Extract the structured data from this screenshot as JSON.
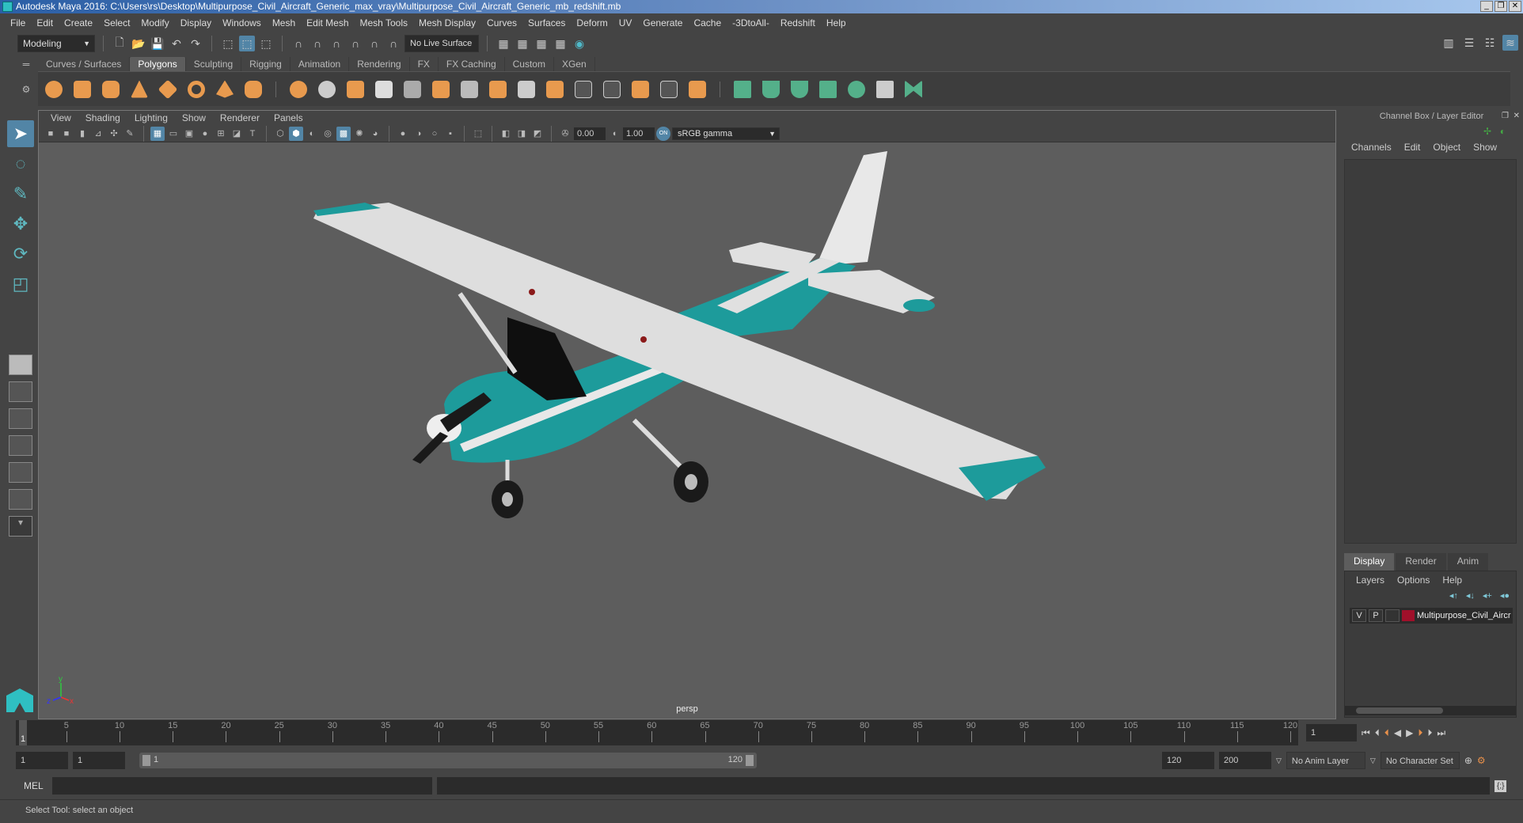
{
  "window": {
    "title": "Autodesk Maya 2016: C:\\Users\\rs\\Desktop\\Multipurpose_Civil_Aircraft_Generic_max_vray\\Multipurpose_Civil_Aircraft_Generic_mb_redshift.mb",
    "minimize": "_",
    "restore": "❐",
    "close": "✕"
  },
  "menu": [
    "File",
    "Edit",
    "Create",
    "Select",
    "Modify",
    "Display",
    "Windows",
    "Mesh",
    "Edit Mesh",
    "Mesh Tools",
    "Mesh Display",
    "Curves",
    "Surfaces",
    "Deform",
    "UV",
    "Generate",
    "Cache",
    "-3DtoAll-",
    "Redshift",
    "Help"
  ],
  "status": {
    "mode": "Modeling",
    "live_surface": "No Live Surface"
  },
  "shelf": {
    "tabs": [
      "Curves / Surfaces",
      "Polygons",
      "Sculpting",
      "Rigging",
      "Animation",
      "Rendering",
      "FX",
      "FX Caching",
      "Custom",
      "XGen"
    ],
    "active": "Polygons"
  },
  "viewport": {
    "menu": [
      "View",
      "Shading",
      "Lighting",
      "Show",
      "Renderer",
      "Panels"
    ],
    "exposure": "0.00",
    "gamma": "1.00",
    "color_space": "sRGB gamma",
    "camera_label": "persp",
    "axis": {
      "x": "x",
      "y": "y",
      "z": "z"
    }
  },
  "channel_box": {
    "title": "Channel Box / Layer Editor",
    "menu": [
      "Channels",
      "Edit",
      "Object",
      "Show"
    ]
  },
  "layer_editor": {
    "tabs": [
      "Display",
      "Render",
      "Anim"
    ],
    "active": "Display",
    "menu": [
      "Layers",
      "Options",
      "Help"
    ],
    "layers": [
      {
        "v": "V",
        "p": "P",
        "color": "#a0102a",
        "name": "Multipurpose_Civil_Aircr"
      }
    ]
  },
  "timeline": {
    "ticks": [
      5,
      10,
      15,
      20,
      25,
      30,
      35,
      40,
      45,
      50,
      55,
      60,
      65,
      70,
      75,
      80,
      85,
      90,
      95,
      100,
      105,
      110,
      115,
      120
    ],
    "current": "1",
    "current_frame_field": "1"
  },
  "range": {
    "start": "1",
    "playback_start": "1",
    "slider_start": "1",
    "slider_end": "120",
    "playback_end": "120",
    "end": "200",
    "anim_layer": "No Anim Layer",
    "character_set": "No Character Set"
  },
  "command": {
    "label": "MEL"
  },
  "help_line": "Select Tool: select an object"
}
